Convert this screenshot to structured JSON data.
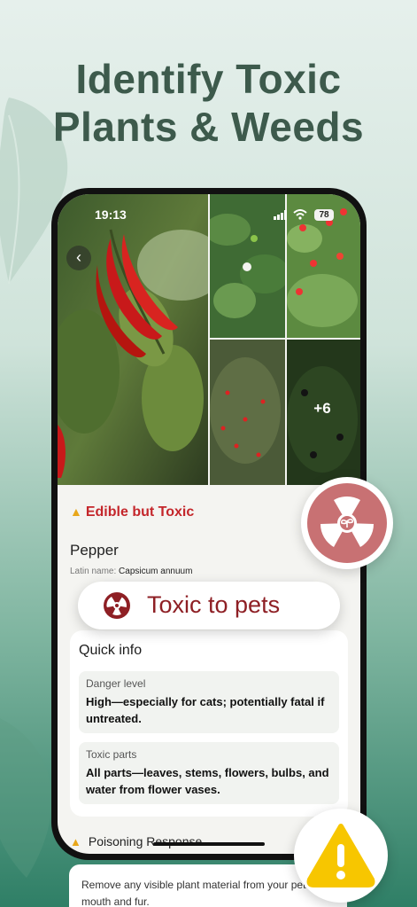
{
  "headline": {
    "line1": "Identify Toxic",
    "line2": "Plants & Weeds"
  },
  "status_bar": {
    "time": "19:13",
    "battery": "78"
  },
  "gallery": {
    "more_count": "+6"
  },
  "plant": {
    "toxicity_status": "Edible but Toxic",
    "name": "Pepper",
    "latin_label": "Latin name:",
    "latin_name": "Capsicum annuum"
  },
  "pets_badge": {
    "label": "Toxic to pets"
  },
  "quick_info": {
    "title": "Quick info",
    "items": [
      {
        "label": "Danger level",
        "value": "High—especially for cats; potentially fatal if untreated."
      },
      {
        "label": "Toxic parts",
        "value": "All parts—leaves, stems, flowers, bulbs, and water from flower vases."
      }
    ]
  },
  "poisoning": {
    "title": "Poisoning Response",
    "text": "Remove any visible plant material from your pet's mouth and fur."
  },
  "colors": {
    "headline": "#3d5a4c",
    "toxic_red": "#c4262b",
    "pets_red": "#8e1f24",
    "warning_yellow": "#f7c600",
    "badge_pink": "#c87173"
  }
}
